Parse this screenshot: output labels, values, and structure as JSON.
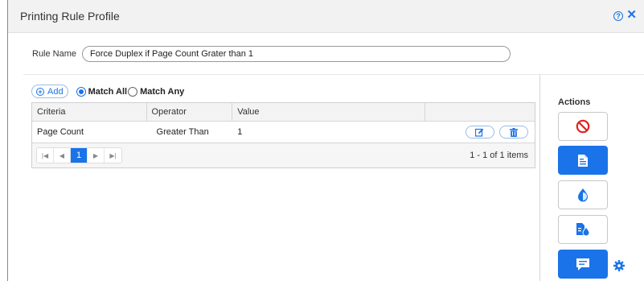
{
  "dialog": {
    "title": "Printing Rule Profile",
    "help_icon": "question-circle-icon",
    "close_icon": "close-icon",
    "help_glyph": "?",
    "close_glyph": "✕"
  },
  "rule": {
    "label": "Rule Name",
    "value": "Force Duplex if Page Count Grater than 1"
  },
  "toolbar": {
    "add_label": "Add",
    "match_all_label": "Match All",
    "match_any_label": "Match Any",
    "selected": "Match All"
  },
  "grid": {
    "headers": [
      "Criteria",
      "Operator",
      "Value",
      ""
    ],
    "rows": [
      {
        "criteria": "Page Count",
        "operator": "Greater Than",
        "value": "1"
      }
    ]
  },
  "pager": {
    "current_page": "1",
    "info": "1 - 1 of 1 items"
  },
  "actions": {
    "header": "Actions",
    "buttons": [
      {
        "name": "block-icon",
        "selected": false
      },
      {
        "name": "document-icon",
        "selected": true
      },
      {
        "name": "toner-drop-icon",
        "selected": false
      },
      {
        "name": "document-toner-icon",
        "selected": false
      },
      {
        "name": "message-icon",
        "selected": true
      }
    ],
    "settings_icon": "gear-icon"
  },
  "colors": {
    "accent": "#1a73e8",
    "block_red": "#e0231c"
  }
}
